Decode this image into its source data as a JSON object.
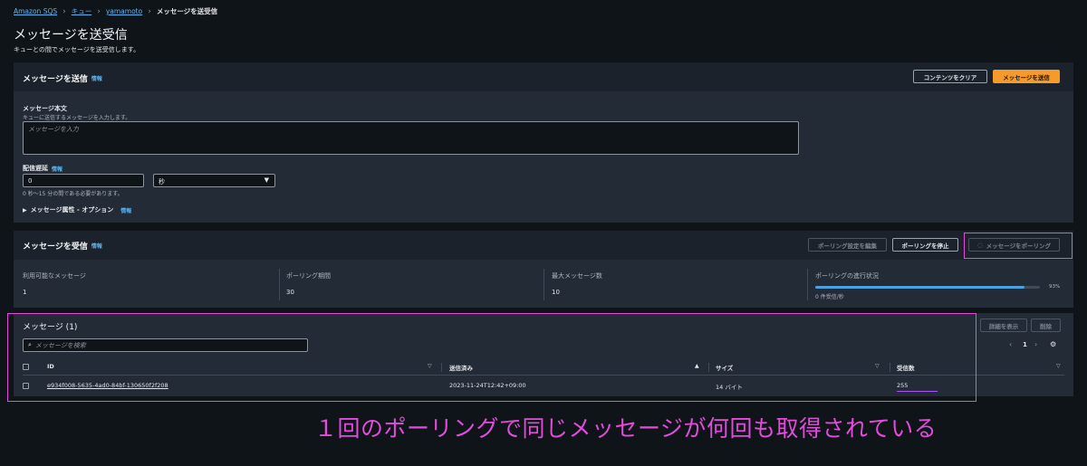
{
  "breadcrumb": [
    "Amazon SQS",
    "キュー",
    "yamamoto",
    "メッセージを送受信"
  ],
  "page": {
    "title": "メッセージを送受信",
    "description": "キューとの間でメッセージを送受信します。"
  },
  "send": {
    "title": "メッセージを送信",
    "info": "情報",
    "clear_button": "コンテンツをクリア",
    "send_button": "メッセージを送信",
    "body_label": "メッセージ本文",
    "body_hint": "キューに送信するメッセージを入力します。",
    "body_placeholder": "メッセージを入力",
    "delay_label": "配信遅延",
    "delay_info": "情報",
    "delay_value": "0",
    "delay_unit": "秒",
    "delay_hint": "0 秒～15 分の間である必要があります。",
    "attributes_label": "メッセージ属性 - オプション",
    "attributes_info": "情報"
  },
  "receive": {
    "title": "メッセージを受信",
    "info": "情報",
    "edit_poll_button": "ポーリング設定を編集",
    "stop_poll_button": "ポーリングを停止",
    "poll_button": "メッセージをポーリング",
    "stats": [
      {
        "label": "利用可能なメッセージ",
        "value": "1"
      },
      {
        "label": "ポーリング期間",
        "value": "30"
      },
      {
        "label": "最大メッセージ数",
        "value": "10"
      },
      {
        "label": "ポーリングの進行状況",
        "value": "0 件受信/秒"
      }
    ],
    "progress_percent": 93,
    "progress_label": "93%"
  },
  "messages": {
    "title": "メッセージ (1)",
    "details_button": "詳細を表示",
    "delete_button": "削除",
    "search_placeholder": "メッセージを検索",
    "page": "1",
    "columns": [
      "ID",
      "送信済み",
      "サイズ",
      "受信数"
    ],
    "rows": [
      {
        "id": "e934f008-5635-4ad0-84bf-130650f2f208",
        "sent": "2023-11-24T12:42+09:00",
        "size": "14 バイト",
        "count": "255"
      }
    ]
  },
  "annotation": "１回のポーリングで同じメッセージが何回も取得されている",
  "colors": {
    "accent": "#f69a2b",
    "highlight": "#e34bdc",
    "link": "#5fb4ef"
  }
}
